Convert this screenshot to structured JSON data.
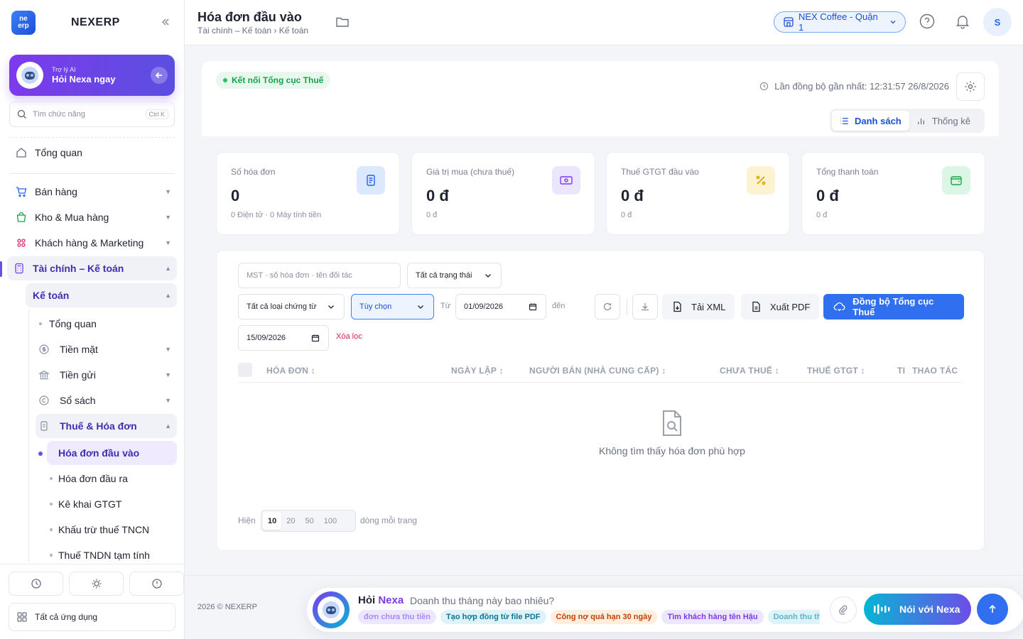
{
  "app": {
    "logo_text": "nex erp",
    "brand": "NEXERP"
  },
  "sidebar": {
    "ai": {
      "small": "Trợ lý AI",
      "big": "Hỏi Nexa ngay"
    },
    "search": {
      "placeholder": "Tìm chức năng",
      "shortcut": "Ctrl K"
    },
    "overview": "Tổng quan",
    "items": [
      {
        "label": "Bán hàng",
        "icon": "cart-icon"
      },
      {
        "label": "Kho & Mua hàng",
        "icon": "bag-icon"
      },
      {
        "label": "Khách hàng & Marketing",
        "icon": "people-icon"
      },
      {
        "label": "Tài chính – Kế toán",
        "icon": "calculator-icon"
      }
    ],
    "accounting": "Kế toán",
    "accounting_items": [
      {
        "label": "Tổng quan"
      },
      {
        "label": "Tiền mặt",
        "icon": "coin-icon"
      },
      {
        "label": "Tiền gửi",
        "icon": "bank-icon"
      },
      {
        "label": "Sổ sách",
        "icon": "ledger-icon"
      },
      {
        "label": "Thuế & Hóa đơn",
        "icon": "receipt-icon"
      }
    ],
    "tax_items": [
      "Hóa đơn đầu vào",
      "Hóa đơn đầu ra",
      "Kê khai GTGT",
      "Khấu trừ thuế TNCN",
      "Thuế TNDN tạm tính"
    ],
    "all_apps": "Tất cả ứng dụng"
  },
  "header": {
    "title": "Hóa đơn đầu vào",
    "breadcrumb": "Tài chính – Kế toán › Kế toán",
    "store": "NEX Coffee - Quận 1",
    "avatar": "S"
  },
  "panel": {
    "connection": "Kết nối Tổng cục Thuế",
    "last_sync": "Lần đồng bộ gần nhất: 12:31:57 26/8/2026",
    "view_list": "Danh sách",
    "view_stats": "Thống kê"
  },
  "stats": [
    {
      "label": "Số hóa đơn",
      "value": "0",
      "sub": "0 Điện tử · 0 Máy tính tiền",
      "icon": "invoice-icon",
      "color": "#dbe8fd",
      "fg": "#2563eb"
    },
    {
      "label": "Giá trị mua (chưa thuế)",
      "value": "0 đ",
      "sub": "0 đ",
      "icon": "cash-icon",
      "color": "#ece6fd",
      "fg": "#7c3aed"
    },
    {
      "label": "Thuế GTGT đầu vào",
      "value": "0 đ",
      "sub": "0 đ",
      "icon": "percent-icon",
      "color": "#fdf3d0",
      "fg": "#d9a300"
    },
    {
      "label": "Tổng thanh toán",
      "value": "0 đ",
      "sub": "0 đ",
      "icon": "wallet-icon",
      "color": "#dcf6e6",
      "fg": "#16a34a"
    }
  ],
  "filters": {
    "search_placeholder": "MST · số hóa đơn · tên đối tác",
    "status": "Tất cả trạng thái",
    "doc_type": "Tất cả loại chứng từ",
    "period": "Tùy chọn",
    "from_label": "Từ",
    "from_date": "01/09/2026",
    "to_label": "đến",
    "to_date": "15/09/2026",
    "clear": "Xóa lọc",
    "xml_btn": "Tải XML",
    "pdf_btn": "Xuất PDF",
    "sync_btn": "Đồng bộ Tổng cục Thuế"
  },
  "table": {
    "columns": [
      "HÓA ĐƠN",
      "NGÀY LẬP",
      "NGƯỜI BÁN (NHÀ CUNG CẤP)",
      "CHƯA THUẾ",
      "THUẾ GTGT",
      "TI",
      "THAO TÁC"
    ],
    "empty": "Không tìm thấy hóa đơn phù hợp"
  },
  "pager": {
    "show": "Hiện",
    "sizes": [
      "10",
      "20",
      "50",
      "100"
    ],
    "selected": "10",
    "suffix": "dòng mỗi trang"
  },
  "footer": {
    "copyright": "2026 © NEXERP",
    "chat_hoi": "Hỏi",
    "chat_nexa": "Nexa",
    "chat_placeholder": "Doanh thu tháng này bao nhiêu?",
    "chips": [
      {
        "text": "đơn chưa thu tiền",
        "bg": "#ede7fd",
        "fg": "#7c3aed"
      },
      {
        "text": "Tạo hợp đồng từ file PDF",
        "bg": "#def3f7",
        "fg": "#0e7490"
      },
      {
        "text": "Công nợ quá hạn 30 ngày",
        "bg": "#fdeedd",
        "fg": "#c2410c"
      },
      {
        "text": "Tìm khách hàng tên Hậu",
        "bg": "#ede7fd",
        "fg": "#7c3aed"
      },
      {
        "text": "Doanh thu tháng",
        "bg": "#def3f7",
        "fg": "#0e7490"
      }
    ],
    "voice": "Nói với Nexa"
  }
}
